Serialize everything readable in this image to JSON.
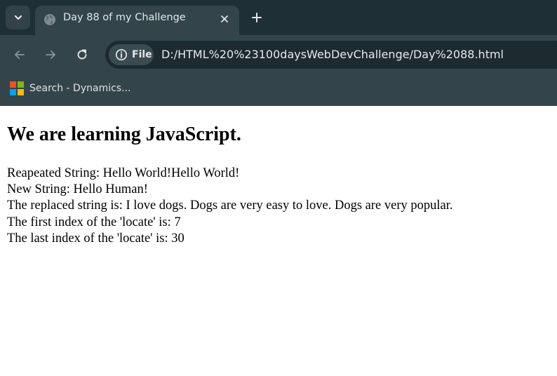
{
  "browser": {
    "tab": {
      "title": "Day 88 of my Challenge"
    },
    "address_bar": {
      "chip_label": "File",
      "url": "D:/HTML%20%23100daysWebDevChallenge/Day%2088.html"
    },
    "bookmarks": [
      {
        "label": "Search - Dynamics..."
      }
    ],
    "colors": {
      "tabstrip": "#1f2f36",
      "toolbar": "#34444b",
      "omnibox": "#1d2a30"
    }
  },
  "page": {
    "heading": "We are learning JavaScript.",
    "lines": [
      "Reapeated String: Hello World!Hello World!",
      "New String: Hello Human!",
      "The replaced string is: I love dogs. Dogs are very easy to love. Dogs are very popular.",
      "The first index of the 'locate' is: 7",
      "The last index of the 'locate' is: 30"
    ]
  }
}
